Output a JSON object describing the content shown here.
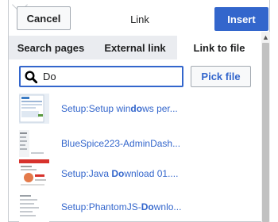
{
  "dialog": {
    "title": "Link",
    "cancel_label": "Cancel",
    "insert_label": "Insert"
  },
  "tabs": [
    {
      "label": "Search pages",
      "active": false
    },
    {
      "label": "External link",
      "active": false
    },
    {
      "label": "Link to file",
      "active": true
    }
  ],
  "search": {
    "value": "Do",
    "pick_file_label": "Pick file"
  },
  "results": [
    {
      "pre": "Setup:Setup win",
      "match": "do",
      "post": "ws per..."
    },
    {
      "pre": "BlueSpice223-AdminDash...",
      "match": "",
      "post": ""
    },
    {
      "pre": "Setup:Java ",
      "match": "Do",
      "post": "wnload 01...."
    },
    {
      "pre": "Setup:PhantomJS-",
      "match": "Do",
      "post": "wnlo..."
    }
  ],
  "colors": {
    "accent": "#3366cc",
    "tab_bar": "#eaecf0",
    "border": "#c8ccd1"
  }
}
